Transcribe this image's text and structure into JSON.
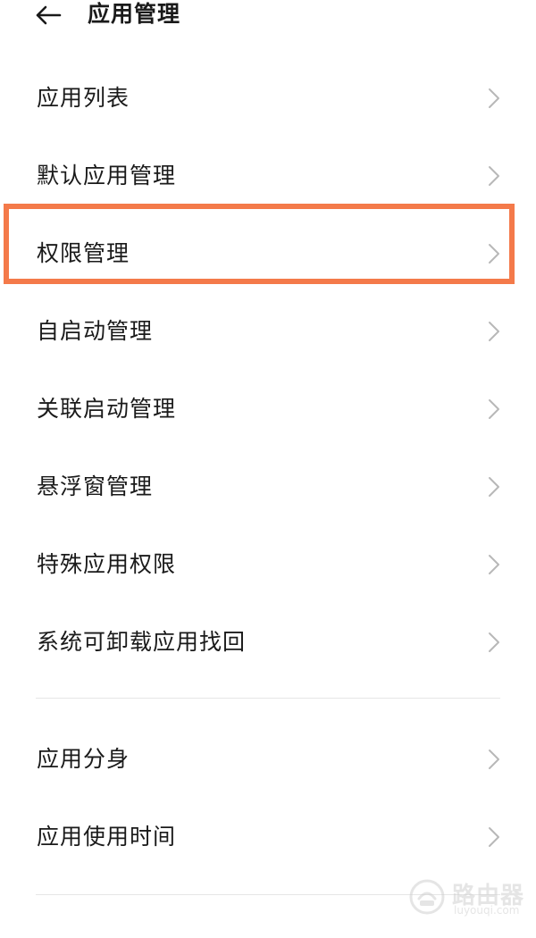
{
  "header": {
    "title": "应用管理",
    "back_icon": "arrow-left-icon"
  },
  "menu": {
    "items": [
      {
        "label": "应用列表"
      },
      {
        "label": "默认应用管理"
      },
      {
        "label": "权限管理"
      },
      {
        "label": "自启动管理"
      },
      {
        "label": "关联启动管理"
      },
      {
        "label": "悬浮窗管理"
      },
      {
        "label": "特殊应用权限"
      },
      {
        "label": "系统可卸载应用找回"
      }
    ],
    "items2": [
      {
        "label": "应用分身"
      },
      {
        "label": "应用使用时间"
      }
    ],
    "highlighted_index": 2,
    "highlight_color": "#f47a4a",
    "chevron_icon": "chevron-right-icon"
  },
  "watermark": {
    "text": "路由器",
    "domain": "luyouqi.com"
  }
}
